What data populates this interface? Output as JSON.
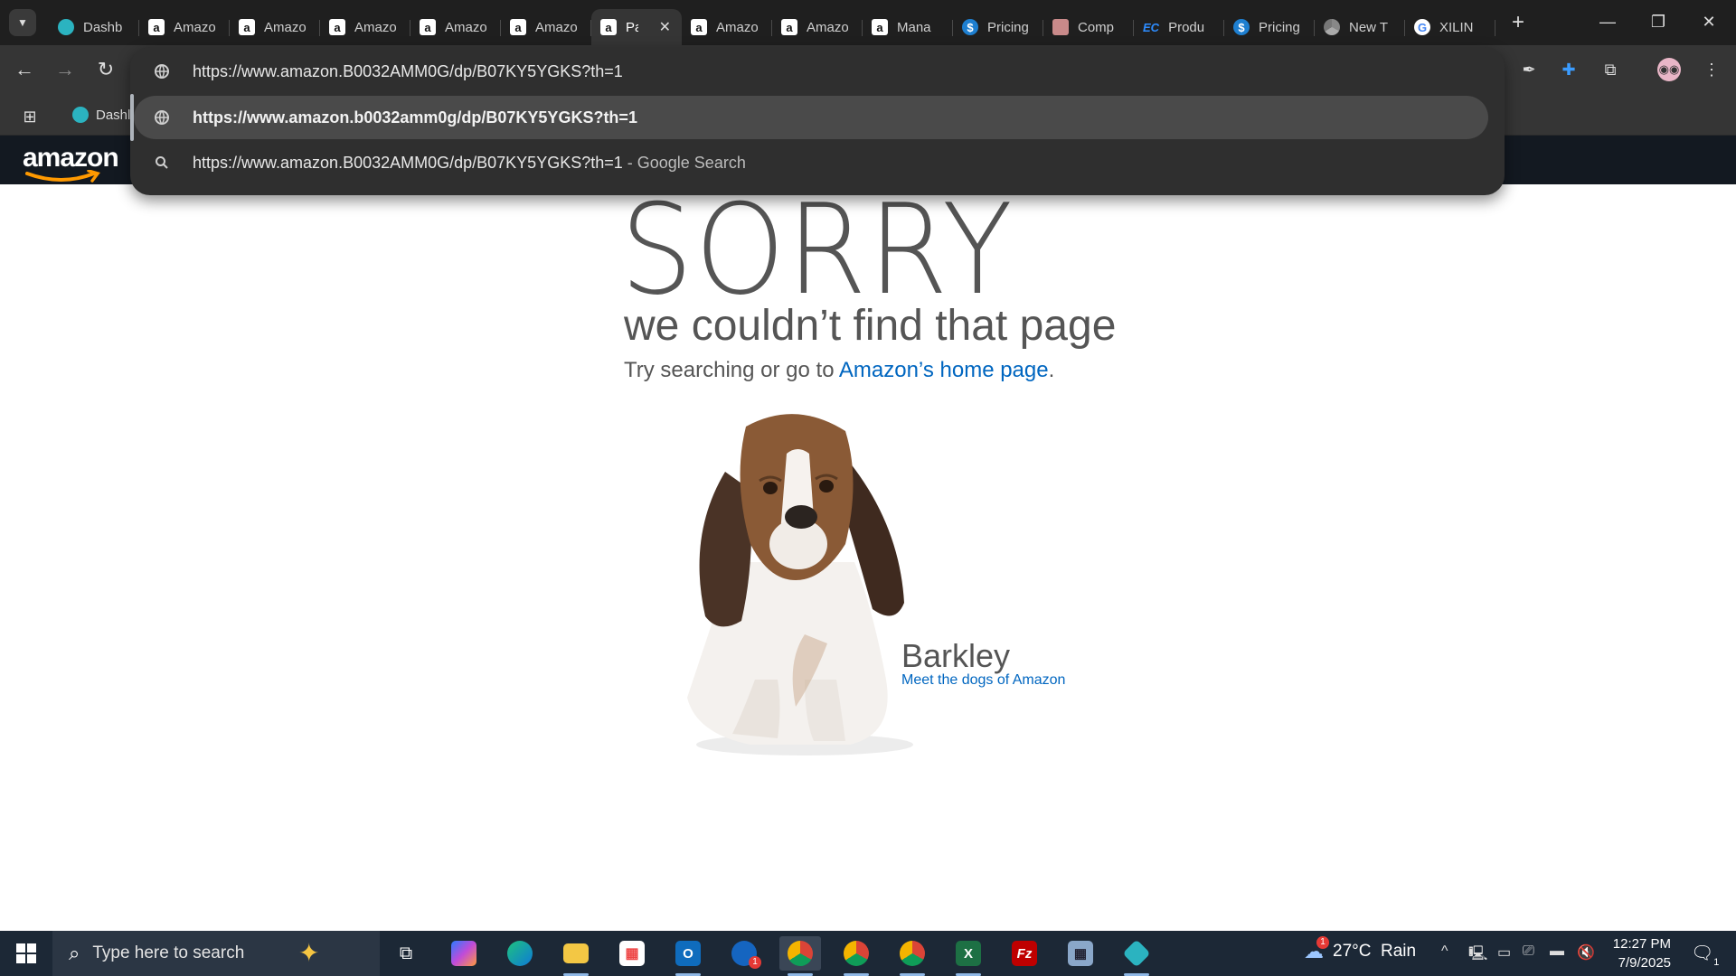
{
  "browser": {
    "tabs": [
      {
        "title": "Dashb",
        "favicon": "dashboard-hex-icon",
        "active": false
      },
      {
        "title": "Amazo",
        "favicon": "amazon-icon",
        "active": false
      },
      {
        "title": "Amazo",
        "favicon": "amazon-icon",
        "active": false
      },
      {
        "title": "Amazo",
        "favicon": "amazon-icon",
        "active": false
      },
      {
        "title": "Amazo",
        "favicon": "amazon-icon",
        "active": false
      },
      {
        "title": "Amazo",
        "favicon": "amazon-icon",
        "active": false
      },
      {
        "title": "Pa",
        "favicon": "amazon-icon",
        "active": true
      },
      {
        "title": "Amazo",
        "favicon": "amazon-icon",
        "active": false
      },
      {
        "title": "Amazo",
        "favicon": "amazon-icon",
        "active": false
      },
      {
        "title": "Mana",
        "favicon": "amazon-icon",
        "active": false
      },
      {
        "title": "Pricing",
        "favicon": "dollar-icon",
        "active": false
      },
      {
        "title": "Comp",
        "favicon": "image-icon",
        "active": false
      },
      {
        "title": "Produ",
        "favicon": "ec-icon",
        "active": false
      },
      {
        "title": "Pricing",
        "favicon": "dollar-icon",
        "active": false
      },
      {
        "title": "New T",
        "favicon": "chrome-icon",
        "active": false
      },
      {
        "title": "XILIN",
        "favicon": "google-icon",
        "active": false
      }
    ],
    "omnibox": {
      "input_value": "https://www.amazon.B0032AMM0G/dp/B07KY5YGKS?th=1",
      "suggestion_url": "https://www.amazon.b0032amm0g/dp/B07KY5YGKS?th=1",
      "suggestion_search": "https://www.amazon.B0032AMM0G/dp/B07KY5YGKS?th=1",
      "suggestion_search_suffix": " - Google Search"
    },
    "bookmarks": {
      "first_label": "Dashl"
    }
  },
  "amazon": {
    "logo_text": "amazon",
    "error_title": "SORRY",
    "error_subtitle": "we couldn’t find that page",
    "try_text": "Try searching or go to ",
    "home_link": "Amazon’s home page",
    "try_end": ".",
    "dog_name": "Barkley",
    "dog_link": "Meet the dogs of Amazon"
  },
  "taskbar": {
    "search_placeholder": "Type here to search",
    "weather": "27°C  Rain",
    "weather_badge": "1",
    "time": "12:27 PM",
    "date": "7/9/2025",
    "notification_count": "1",
    "app_badge": "1"
  },
  "colors": {
    "link": "#0066c0",
    "amazon_nav": "#131921",
    "chrome_dark": "#1f1f1f"
  }
}
